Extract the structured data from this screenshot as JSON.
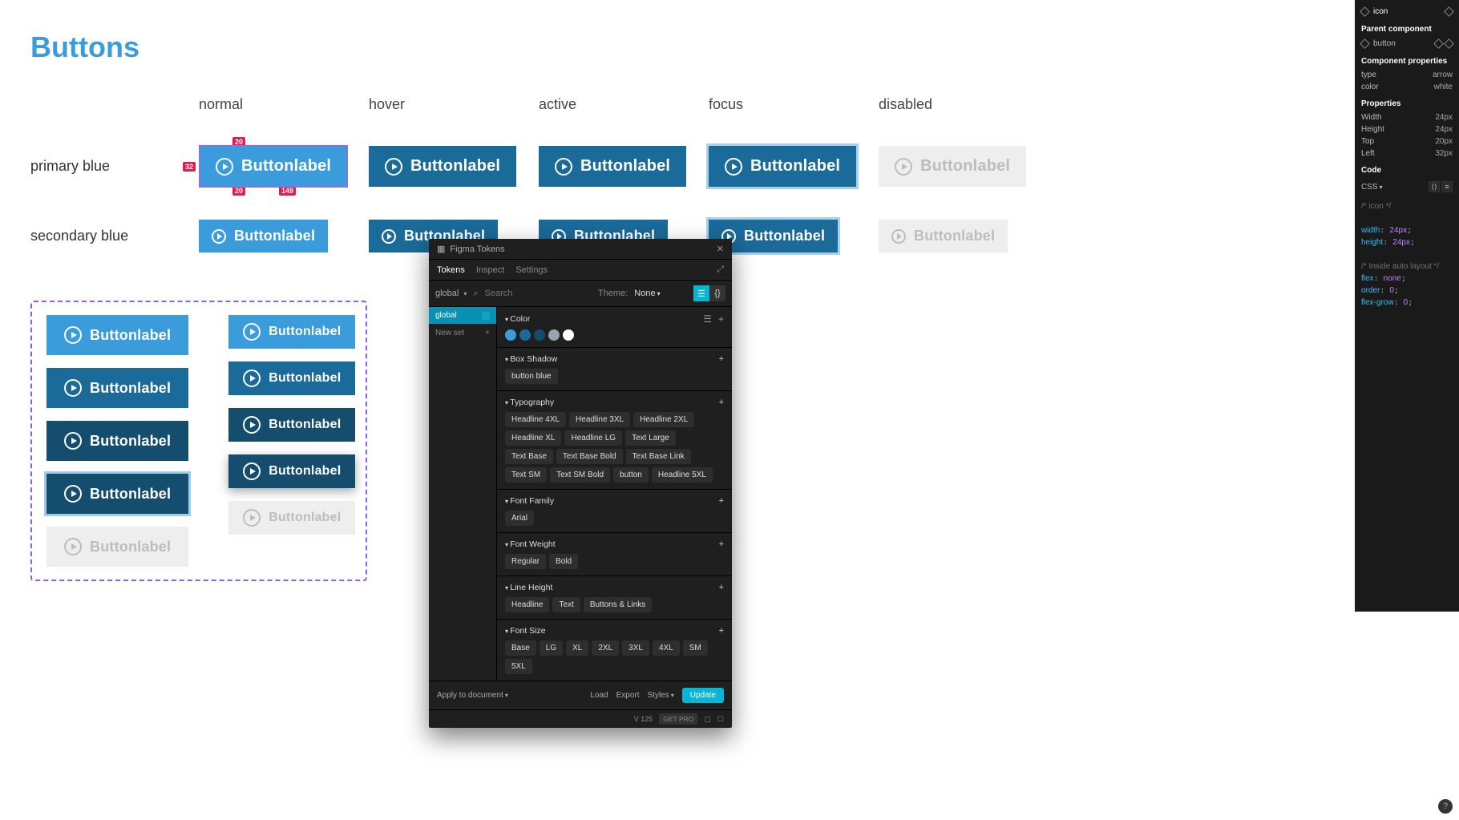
{
  "page_title": "Buttons",
  "columns": [
    "normal",
    "hover",
    "active",
    "focus",
    "disabled"
  ],
  "rows": [
    {
      "label": "primary blue",
      "button_label": "Buttonlabel"
    },
    {
      "label": "secondary blue",
      "button_label": "Buttonlabel"
    }
  ],
  "selection_measurements": {
    "top": "20",
    "left": "32",
    "bottom": "20",
    "width_label": "149"
  },
  "showcase": {
    "variants": [
      "Buttonlabel",
      "Buttonlabel",
      "Buttonlabel",
      "Buttonlabel",
      "Buttonlabel"
    ],
    "variants_small": [
      "Buttonlabel",
      "Buttonlabel",
      "Buttonlabel",
      "Buttonlabel",
      "Buttonlabel"
    ]
  },
  "plugin": {
    "title": "Figma Tokens",
    "tabs": [
      "Tokens",
      "Inspect",
      "Settings"
    ],
    "active_tab": "Tokens",
    "set_selector": "global",
    "search_placeholder": "Search",
    "theme_label": "Theme:",
    "theme_value": "None",
    "sidebar": {
      "items": [
        "global"
      ],
      "new_set": "New set"
    },
    "sections": {
      "color": {
        "title": "Color",
        "swatches": [
          "#3b9cdc",
          "#1a6a9a",
          "#154d6f",
          "#9ca3af",
          "#ffffff"
        ]
      },
      "box_shadow": {
        "title": "Box Shadow",
        "tokens": [
          "button blue"
        ]
      },
      "typography": {
        "title": "Typography",
        "tokens": [
          "Headline 4XL",
          "Headline 3XL",
          "Headline 2XL",
          "Headline XL",
          "Headline LG",
          "Text Large",
          "Text Base",
          "Text Base Bold",
          "Text Base Link",
          "Text SM",
          "Text SM Bold",
          "button",
          "Headline 5XL"
        ]
      },
      "font_family": {
        "title": "Font Family",
        "tokens": [
          "Arial"
        ]
      },
      "font_weight": {
        "title": "Font Weight",
        "tokens": [
          "Regular",
          "Bold"
        ]
      },
      "line_height": {
        "title": "Line Height",
        "tokens": [
          "Headline",
          "Text",
          "Buttons & Links"
        ]
      },
      "font_size": {
        "title": "Font Size",
        "tokens": [
          "Base",
          "LG",
          "XL",
          "2XL",
          "3XL",
          "4XL",
          "SM",
          "5XL"
        ]
      }
    },
    "footer": {
      "apply": "Apply to document",
      "load": "Load",
      "export": "Export",
      "styles": "Styles",
      "update": "Update"
    },
    "version": "V 125",
    "get_pro": "GET PRO"
  },
  "inspector": {
    "selected": "icon",
    "parent_heading": "Parent component",
    "parent_name": "button",
    "props_heading": "Component properties",
    "props": [
      {
        "k": "type",
        "v": "arrow"
      },
      {
        "k": "color",
        "v": "white"
      }
    ],
    "properties_heading": "Properties",
    "properties": [
      {
        "k": "Width",
        "v": "24px"
      },
      {
        "k": "Height",
        "v": "24px"
      },
      {
        "k": "Top",
        "v": "20px"
      },
      {
        "k": "Left",
        "v": "32px"
      }
    ],
    "code_heading": "Code",
    "code_lang": "CSS",
    "code": "/* icon */\n\nwidth: 24px;\nheight: 24px;\n\n/* Inside auto layout */\nflex: none;\norder: 0;\nflex-grow: 0;"
  }
}
